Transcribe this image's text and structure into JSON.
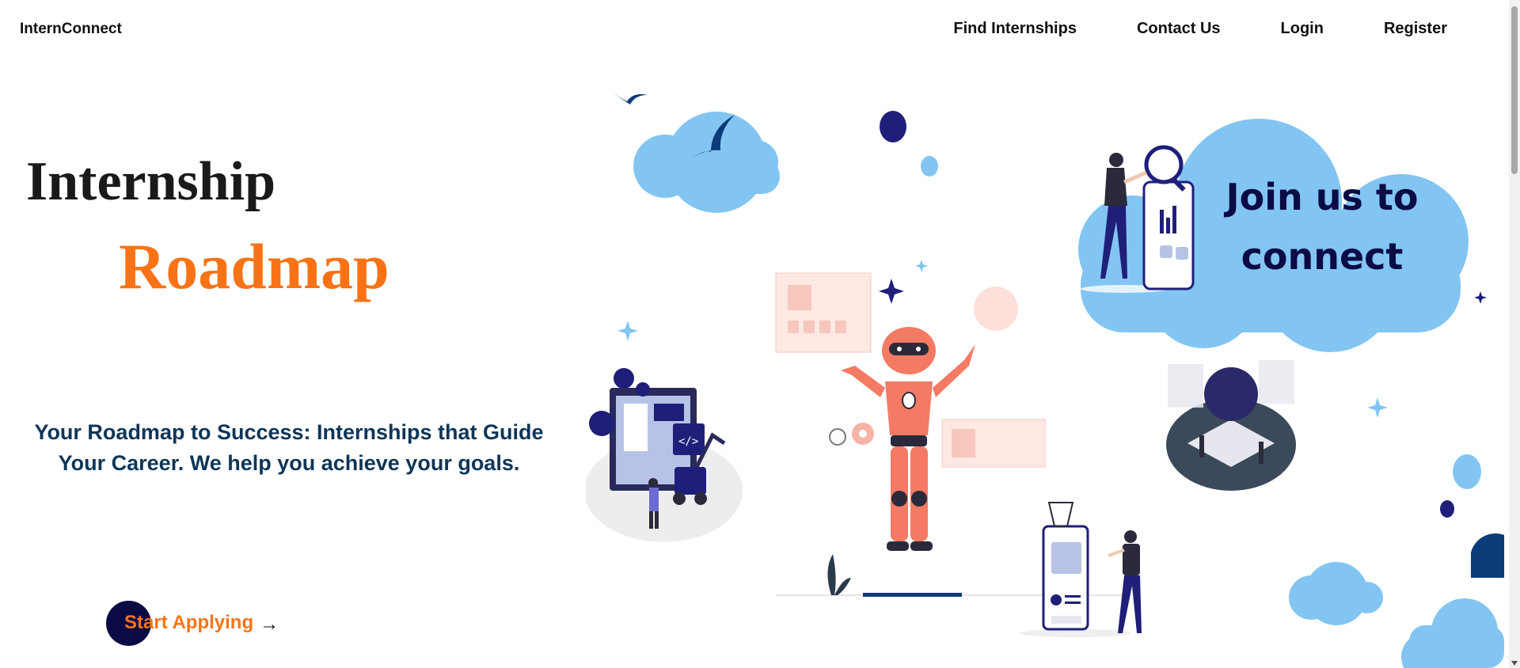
{
  "nav": {
    "brand": "InternConnect",
    "links": [
      "Find Internships",
      "Contact Us",
      "Login",
      "Register"
    ]
  },
  "hero": {
    "title_line1": "Internship",
    "title_line2": "Roadmap",
    "tagline": "Your Roadmap to Success: Internships that Guide Your Career. We help you achieve your goals.",
    "cta_label": "Start Applying",
    "cta_arrow": "→"
  },
  "illustration": {
    "cloud_text_line1": "Join us to",
    "cloud_text_line2": "connect"
  },
  "colors": {
    "accent_orange": "#f97316",
    "navy": "#0a0a45",
    "tagline_blue": "#0e3557",
    "cloud_blue": "#82c5f2",
    "robot_coral": "#f47a64"
  }
}
